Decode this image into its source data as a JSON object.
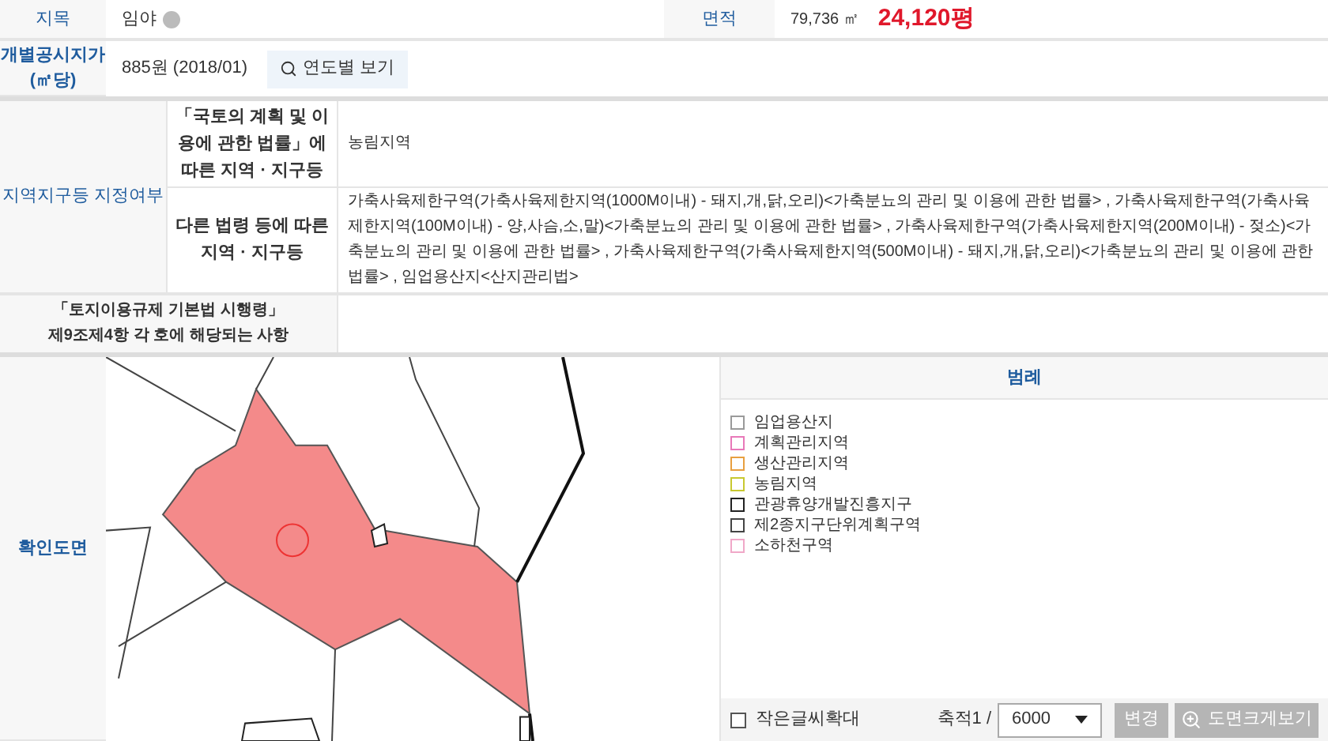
{
  "land_category": {
    "label": "지목",
    "value": "임야"
  },
  "area": {
    "label": "면적",
    "sqm": "79,736 ㎡",
    "pyeong": "24,120평"
  },
  "official_price": {
    "label": "개별공시지가\n(㎡당)",
    "value": "885원 (2018/01)",
    "button": "연도별 보기"
  },
  "zoning": {
    "label": "지역지구등 지정여부",
    "rows": [
      {
        "label": "「국토의 계획 및 이용에 관한 법률」에 따른 지역 · 지구등",
        "value": "농림지역"
      },
      {
        "label": "다른 법령 등에 따른 지역 · 지구등",
        "value": "가축사육제한구역(가축사육제한지역(1000M이내) - 돼지,개,닭,오리)<가축분뇨의 관리 및 이용에 관한 법률> , 가축사육제한구역(가축사육제한지역(100M이내) - 양,사슴,소,말)<가축분뇨의 관리 및 이용에 관한 법률> , 가축사육제한구역(가축사육제한지역(200M이내) - 젖소)<가축분뇨의 관리 및 이용에 관한 법률> , 가축사육제한구역(가축사육제한지역(500M이내) - 돼지,개,닭,오리)<가축분뇨의 관리 및 이용에 관한 법률> , 임업용산지<산지관리법>"
      }
    ]
  },
  "enforcement": {
    "label": "「토지이용규제 기본법 시행령」\n제9조제4항 각 호에 해당되는 사항"
  },
  "map_section": {
    "label": "확인도면",
    "legend": {
      "title": "범례",
      "items": [
        {
          "label": "임업용산지",
          "color": "#9a9a9a"
        },
        {
          "label": "계획관리지역",
          "color": "#e879b9"
        },
        {
          "label": "생산관리지역",
          "color": "#e8a040"
        },
        {
          "label": "농림지역",
          "color": "#c8c830"
        },
        {
          "label": "관광휴양개발진흥지구",
          "color": "#222222"
        },
        {
          "label": "제2종지구단위계획구역",
          "color": "#444444"
        },
        {
          "label": "소하천구역",
          "color": "#f0a8c8"
        }
      ]
    },
    "enlarge_small_text": {
      "label": "작은글씨확대",
      "checked": false
    },
    "scale": {
      "label": "축적1 /",
      "value": "6000"
    },
    "buttons": [
      "변경",
      "도면크게보기"
    ]
  }
}
